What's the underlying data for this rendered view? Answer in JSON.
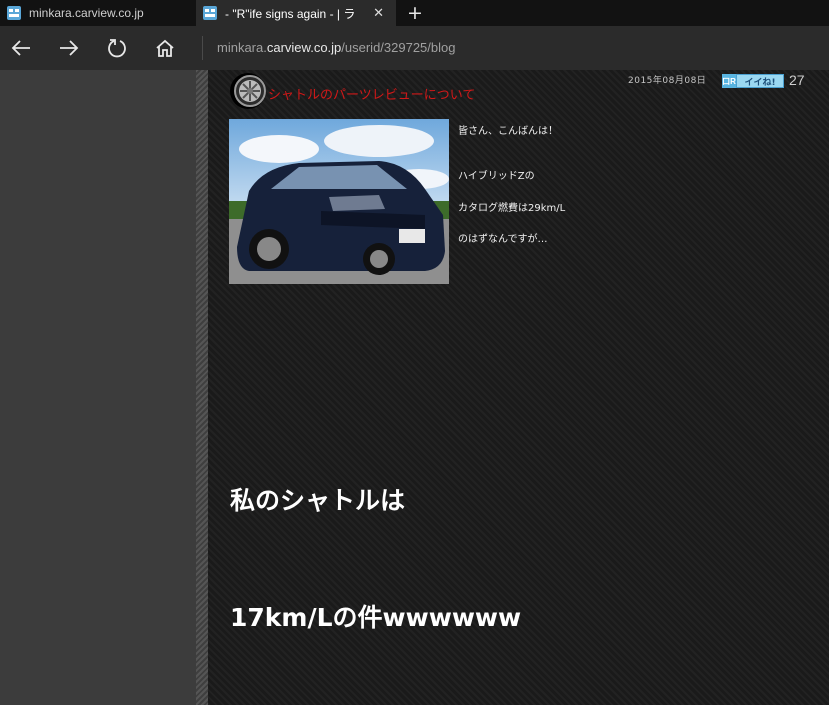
{
  "browser": {
    "tabs": [
      {
        "title": "minkara.carview.co.jp",
        "active": false
      },
      {
        "title": "- \"R\"ife signs again - | ラ",
        "active": true
      }
    ],
    "new_tab_symbol": "+",
    "close_symbol": "✕",
    "address": {
      "prefix": "minkara.",
      "host": "carview.co.jp",
      "path": "/userid/329725/blog"
    }
  },
  "post": {
    "title": "シャトルのパーツレビューについて",
    "date": "2015年08月08日",
    "like_badge_left": "口R",
    "like_badge_right": "イイね!",
    "like_count": "27",
    "excerpt": [
      "皆さん、こんばんは！",
      "ハイブリッドZの",
      "カタログ燃費は29km/L",
      "のはずなんですが…"
    ],
    "big_lines": [
      "私のシャトルは",
      "17km/Lの件wwwwww"
    ]
  },
  "colors": {
    "title_red": "#d01818",
    "page_bg": "#1b1b1b",
    "sidebar": "#3c3c3c",
    "chrome": "#2b2b2b"
  }
}
